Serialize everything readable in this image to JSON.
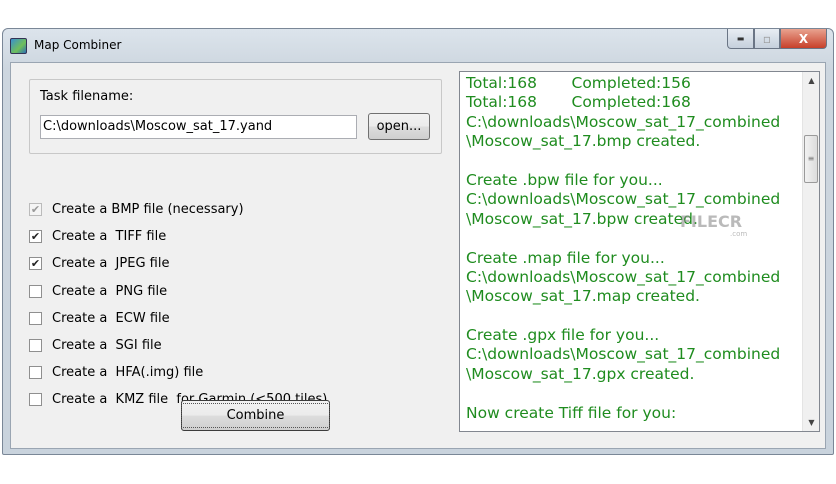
{
  "window": {
    "title": "Map Combiner",
    "minimize": "▬",
    "maximize": "▫",
    "close": "X"
  },
  "task": {
    "label": "Task filename:",
    "filename": "C:\\downloads\\Moscow_sat_17.yand",
    "open_label": "open..."
  },
  "options": [
    {
      "label": "Create a BMP file (necessary)",
      "checked": true,
      "disabled": true
    },
    {
      "label": "Create a  TIFF file",
      "checked": true,
      "disabled": false
    },
    {
      "label": "Create a  JPEG file",
      "checked": true,
      "disabled": false
    },
    {
      "label": "Create a  PNG file",
      "checked": false,
      "disabled": false
    },
    {
      "label": "Create a  ECW file",
      "checked": false,
      "disabled": false
    },
    {
      "label": "Create a  SGI file",
      "checked": false,
      "disabled": false
    },
    {
      "label": "Create a  HFA(.img) file",
      "checked": false,
      "disabled": false
    },
    {
      "label": "Create a  KMZ file  for Garmin (<500 tiles)",
      "checked": false,
      "disabled": false
    }
  ],
  "combine_label": "Combine",
  "log": {
    "lines": [
      "Total:168       Completed:156",
      "Total:168       Completed:168",
      "C:\\downloads\\Moscow_sat_17_combined",
      "\\Moscow_sat_17.bmp created.",
      "",
      "Create .bpw file for you...",
      "C:\\downloads\\Moscow_sat_17_combined",
      "\\Moscow_sat_17.bpw created.",
      "",
      "Create .map file for you...",
      "C:\\downloads\\Moscow_sat_17_combined",
      "\\Moscow_sat_17.map created.",
      "",
      "Create .gpx file for you...",
      "C:\\downloads\\Moscow_sat_17_combined",
      "\\Moscow_sat_17.gpx created.",
      "",
      "Now create Tiff file for you:"
    ],
    "text_color": "#1f8c1f"
  },
  "watermark": "FILECR .com"
}
